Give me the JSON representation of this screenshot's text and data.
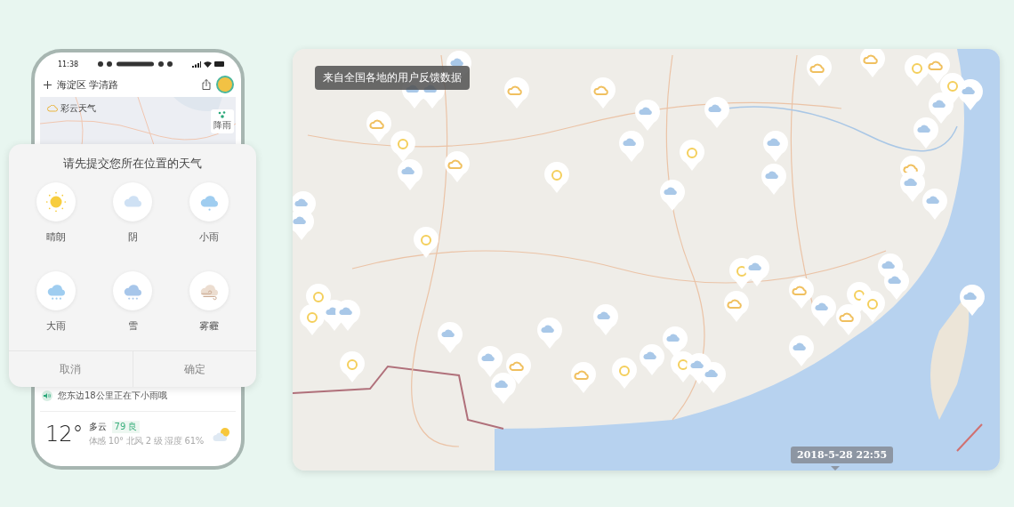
{
  "phone": {
    "status_time": "11:38",
    "location": "海淀区 学清路",
    "map_logo": "彩云天气",
    "map_button": "降雨",
    "notice": "您东边18公里正在下小雨哦",
    "current": {
      "temperature": "12°",
      "condition": "多云",
      "aqi": "79 良",
      "details": "体感 10° 北风 2 级 湿度 61%"
    }
  },
  "dialog": {
    "title": "请先提交您所在位置的天气",
    "options": [
      {
        "kind": "sunny",
        "label": "晴朗"
      },
      {
        "kind": "cloudy",
        "label": "阴"
      },
      {
        "kind": "light-rain",
        "label": "小雨"
      },
      {
        "kind": "heavy-rain",
        "label": "大雨"
      },
      {
        "kind": "snow",
        "label": "雪"
      },
      {
        "kind": "haze",
        "label": "雾霾"
      }
    ],
    "buttons": [
      "取消",
      "确定"
    ]
  },
  "map": {
    "caption": "来自全国各地的用户反馈数据",
    "timestamp": "2018-5-28 22:55"
  }
}
